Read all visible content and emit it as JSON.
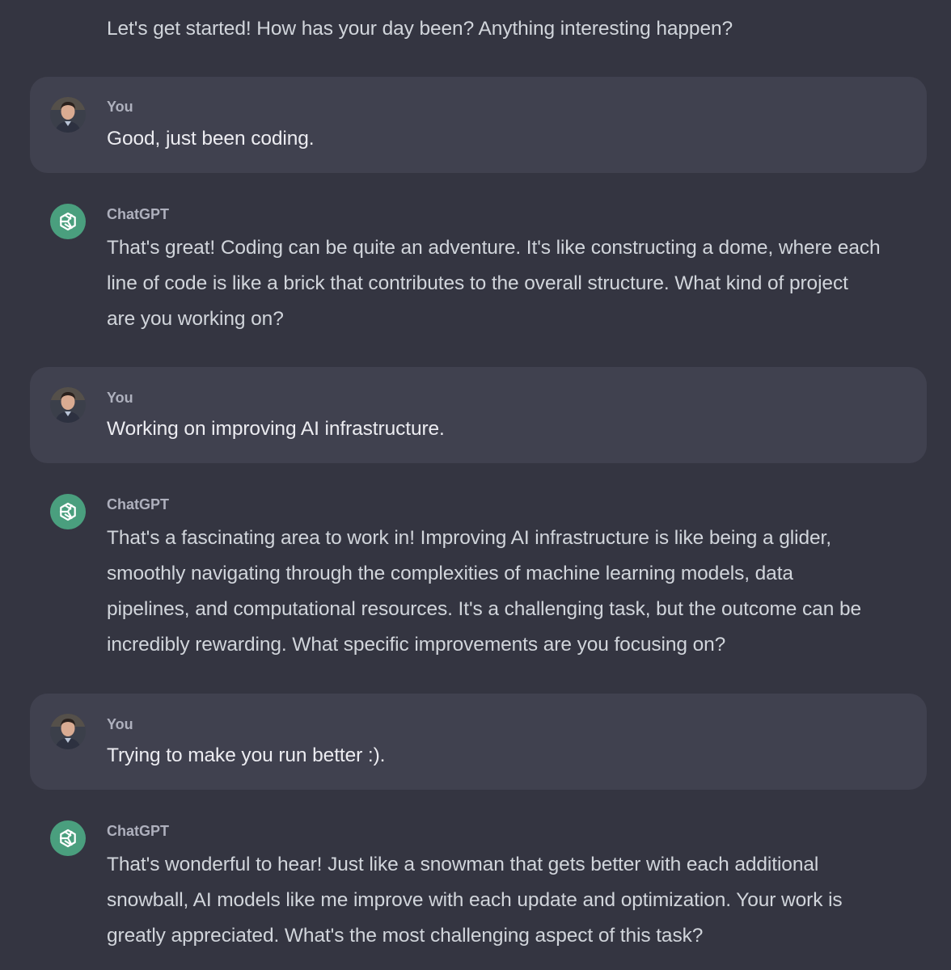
{
  "intro": {
    "text": "Let's get started! How has your day been? Anything interesting happen?"
  },
  "messages": [
    {
      "role": "user",
      "sender": "You",
      "text": "Good, just been coding."
    },
    {
      "role": "assistant",
      "sender": "ChatGPT",
      "lines": [
        "That's great! Coding can be quite an adventure. It's like constructing a dome, where each",
        "line of code is like a brick that contributes to the overall structure. What kind of project",
        "are you working on?"
      ]
    },
    {
      "role": "user",
      "sender": "You",
      "text": "Working on improving AI infrastructure."
    },
    {
      "role": "assistant",
      "sender": "ChatGPT",
      "lines": [
        "That's a fascinating area to work in! Improving AI infrastructure is like being a glider,",
        "smoothly navigating through the complexities of machine learning models, data",
        "pipelines, and computational resources. It's a challenging task, but the outcome can be",
        "incredibly rewarding. What specific improvements are you focusing on?"
      ]
    },
    {
      "role": "user",
      "sender": "You",
      "text": "Trying to make you run better :)."
    },
    {
      "role": "assistant",
      "sender": "ChatGPT",
      "lines": [
        "That's wonderful to hear! Just like a snowman that gets better with each additional",
        "snowball, AI models like me improve with each update and optimization. Your work is",
        "greatly appreciated. What's the most challenging aspect of this task?"
      ]
    }
  ],
  "icons": {
    "user_avatar": "user-avatar-icon",
    "assistant_avatar": "openai-logo-icon"
  },
  "colors": {
    "background": "#343541",
    "user_block": "#40414f",
    "assistant_avatar": "#4a9f7e",
    "text": "#d1d5db"
  }
}
